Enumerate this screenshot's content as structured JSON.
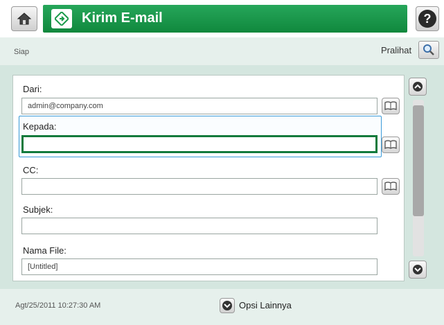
{
  "header": {
    "title": "Kirim E-mail",
    "home_icon": "home-icon",
    "app_icon": "email-send-icon",
    "help_icon": "help-icon",
    "help_glyph": "?",
    "accent_color": "#1a9a4a"
  },
  "status": {
    "text": "Siap",
    "preview_label": "Pralihat"
  },
  "form": {
    "from": {
      "label": "Dari:",
      "value": "admin@company.com"
    },
    "to": {
      "label": "Kepada:",
      "value": ""
    },
    "cc": {
      "label": "CC:",
      "value": ""
    },
    "subject": {
      "label": "Subjek:",
      "value": ""
    },
    "filename": {
      "label": "Nama File:",
      "value": "[Untitled]"
    }
  },
  "footer": {
    "datetime": "Agt/25/2011 10:27:30 AM",
    "more_options_label": "Opsi Lainnya"
  }
}
